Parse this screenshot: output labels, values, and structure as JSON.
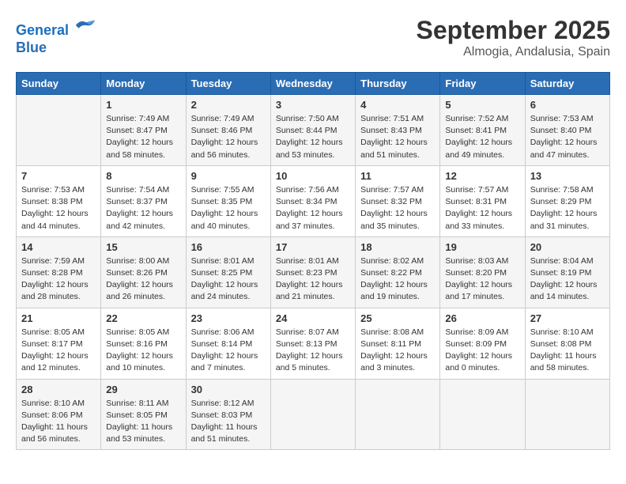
{
  "header": {
    "logo_line1": "General",
    "logo_line2": "Blue",
    "month": "September 2025",
    "location": "Almogia, Andalusia, Spain"
  },
  "weekdays": [
    "Sunday",
    "Monday",
    "Tuesday",
    "Wednesday",
    "Thursday",
    "Friday",
    "Saturday"
  ],
  "weeks": [
    [
      {
        "day": "",
        "info": ""
      },
      {
        "day": "1",
        "info": "Sunrise: 7:49 AM\nSunset: 8:47 PM\nDaylight: 12 hours\nand 58 minutes."
      },
      {
        "day": "2",
        "info": "Sunrise: 7:49 AM\nSunset: 8:46 PM\nDaylight: 12 hours\nand 56 minutes."
      },
      {
        "day": "3",
        "info": "Sunrise: 7:50 AM\nSunset: 8:44 PM\nDaylight: 12 hours\nand 53 minutes."
      },
      {
        "day": "4",
        "info": "Sunrise: 7:51 AM\nSunset: 8:43 PM\nDaylight: 12 hours\nand 51 minutes."
      },
      {
        "day": "5",
        "info": "Sunrise: 7:52 AM\nSunset: 8:41 PM\nDaylight: 12 hours\nand 49 minutes."
      },
      {
        "day": "6",
        "info": "Sunrise: 7:53 AM\nSunset: 8:40 PM\nDaylight: 12 hours\nand 47 minutes."
      }
    ],
    [
      {
        "day": "7",
        "info": "Sunrise: 7:53 AM\nSunset: 8:38 PM\nDaylight: 12 hours\nand 44 minutes."
      },
      {
        "day": "8",
        "info": "Sunrise: 7:54 AM\nSunset: 8:37 PM\nDaylight: 12 hours\nand 42 minutes."
      },
      {
        "day": "9",
        "info": "Sunrise: 7:55 AM\nSunset: 8:35 PM\nDaylight: 12 hours\nand 40 minutes."
      },
      {
        "day": "10",
        "info": "Sunrise: 7:56 AM\nSunset: 8:34 PM\nDaylight: 12 hours\nand 37 minutes."
      },
      {
        "day": "11",
        "info": "Sunrise: 7:57 AM\nSunset: 8:32 PM\nDaylight: 12 hours\nand 35 minutes."
      },
      {
        "day": "12",
        "info": "Sunrise: 7:57 AM\nSunset: 8:31 PM\nDaylight: 12 hours\nand 33 minutes."
      },
      {
        "day": "13",
        "info": "Sunrise: 7:58 AM\nSunset: 8:29 PM\nDaylight: 12 hours\nand 31 minutes."
      }
    ],
    [
      {
        "day": "14",
        "info": "Sunrise: 7:59 AM\nSunset: 8:28 PM\nDaylight: 12 hours\nand 28 minutes."
      },
      {
        "day": "15",
        "info": "Sunrise: 8:00 AM\nSunset: 8:26 PM\nDaylight: 12 hours\nand 26 minutes."
      },
      {
        "day": "16",
        "info": "Sunrise: 8:01 AM\nSunset: 8:25 PM\nDaylight: 12 hours\nand 24 minutes."
      },
      {
        "day": "17",
        "info": "Sunrise: 8:01 AM\nSunset: 8:23 PM\nDaylight: 12 hours\nand 21 minutes."
      },
      {
        "day": "18",
        "info": "Sunrise: 8:02 AM\nSunset: 8:22 PM\nDaylight: 12 hours\nand 19 minutes."
      },
      {
        "day": "19",
        "info": "Sunrise: 8:03 AM\nSunset: 8:20 PM\nDaylight: 12 hours\nand 17 minutes."
      },
      {
        "day": "20",
        "info": "Sunrise: 8:04 AM\nSunset: 8:19 PM\nDaylight: 12 hours\nand 14 minutes."
      }
    ],
    [
      {
        "day": "21",
        "info": "Sunrise: 8:05 AM\nSunset: 8:17 PM\nDaylight: 12 hours\nand 12 minutes."
      },
      {
        "day": "22",
        "info": "Sunrise: 8:05 AM\nSunset: 8:16 PM\nDaylight: 12 hours\nand 10 minutes."
      },
      {
        "day": "23",
        "info": "Sunrise: 8:06 AM\nSunset: 8:14 PM\nDaylight: 12 hours\nand 7 minutes."
      },
      {
        "day": "24",
        "info": "Sunrise: 8:07 AM\nSunset: 8:13 PM\nDaylight: 12 hours\nand 5 minutes."
      },
      {
        "day": "25",
        "info": "Sunrise: 8:08 AM\nSunset: 8:11 PM\nDaylight: 12 hours\nand 3 minutes."
      },
      {
        "day": "26",
        "info": "Sunrise: 8:09 AM\nSunset: 8:09 PM\nDaylight: 12 hours\nand 0 minutes."
      },
      {
        "day": "27",
        "info": "Sunrise: 8:10 AM\nSunset: 8:08 PM\nDaylight: 11 hours\nand 58 minutes."
      }
    ],
    [
      {
        "day": "28",
        "info": "Sunrise: 8:10 AM\nSunset: 8:06 PM\nDaylight: 11 hours\nand 56 minutes."
      },
      {
        "day": "29",
        "info": "Sunrise: 8:11 AM\nSunset: 8:05 PM\nDaylight: 11 hours\nand 53 minutes."
      },
      {
        "day": "30",
        "info": "Sunrise: 8:12 AM\nSunset: 8:03 PM\nDaylight: 11 hours\nand 51 minutes."
      },
      {
        "day": "",
        "info": ""
      },
      {
        "day": "",
        "info": ""
      },
      {
        "day": "",
        "info": ""
      },
      {
        "day": "",
        "info": ""
      }
    ]
  ]
}
